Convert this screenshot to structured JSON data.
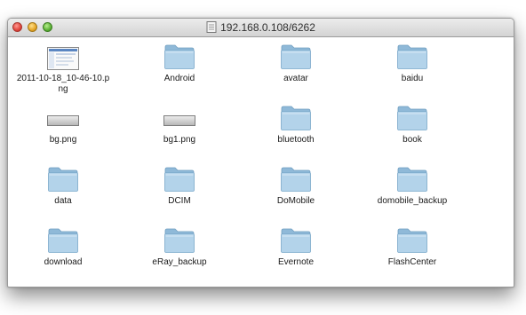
{
  "window": {
    "title": "192.168.0.108/6262",
    "title_icon": "network-drive-icon"
  },
  "colors": {
    "folder_light": "#bcd8ec",
    "folder_dark": "#8bb6d5"
  },
  "files": [
    {
      "name": "2011-10-18_10-46-10.p\nng",
      "kind": "image-thumbnail",
      "icon": "png-thumbnail-icon"
    },
    {
      "name": "Android",
      "kind": "folder",
      "icon": "folder-icon"
    },
    {
      "name": "avatar",
      "kind": "folder",
      "icon": "folder-icon"
    },
    {
      "name": "baidu",
      "kind": "folder",
      "icon": "folder-icon"
    },
    {
      "name": "bg.png",
      "kind": "image-bar",
      "icon": "png-file-icon"
    },
    {
      "name": "bg1.png",
      "kind": "image-bar",
      "icon": "png-file-icon"
    },
    {
      "name": "bluetooth",
      "kind": "folder",
      "icon": "folder-icon"
    },
    {
      "name": "book",
      "kind": "folder",
      "icon": "folder-icon"
    },
    {
      "name": "data",
      "kind": "folder",
      "icon": "folder-icon"
    },
    {
      "name": "DCIM",
      "kind": "folder",
      "icon": "folder-icon"
    },
    {
      "name": "DoMobile",
      "kind": "folder",
      "icon": "folder-icon"
    },
    {
      "name": "domobile_backup",
      "kind": "folder",
      "icon": "folder-icon"
    },
    {
      "name": "download",
      "kind": "folder",
      "icon": "folder-icon"
    },
    {
      "name": "eRay_backup",
      "kind": "folder",
      "icon": "folder-icon"
    },
    {
      "name": "Evernote",
      "kind": "folder",
      "icon": "folder-icon"
    },
    {
      "name": "FlashCenter",
      "kind": "folder",
      "icon": "folder-icon"
    }
  ]
}
